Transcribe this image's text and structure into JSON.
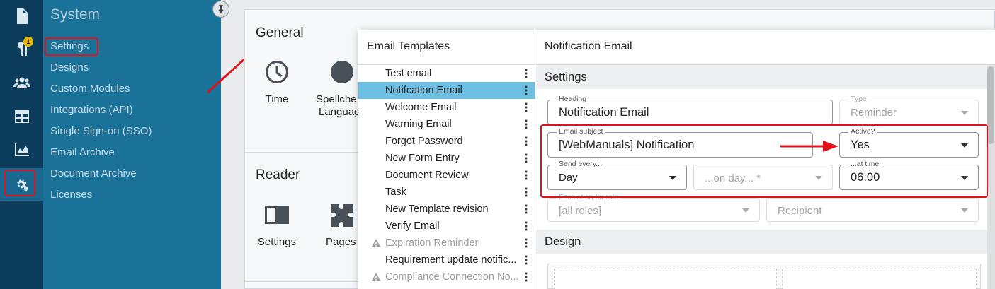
{
  "rail": {
    "badge_count": "1",
    "items": [
      "document-icon",
      "paragraph-icon",
      "users-icon",
      "table-icon",
      "chart-icon",
      "settings-gears-icon"
    ]
  },
  "sidemenu": {
    "title": "System",
    "items": [
      "Settings",
      "Designs",
      "Custom Modules",
      "Integrations (API)",
      "Single Sign-on (SSO)",
      "Email Archive",
      "Document Archive",
      "Licenses"
    ]
  },
  "background": {
    "general_heading": "General",
    "general_items": [
      "Time",
      "Spellche",
      "Languag"
    ],
    "reader_heading": "Reader",
    "reader_items": [
      "Settings",
      "Pages"
    ]
  },
  "email_templates": {
    "title": "Email Templates",
    "items": [
      {
        "label": "Test email",
        "warning": false
      },
      {
        "label": "Notifcation Email",
        "warning": false,
        "selected": true
      },
      {
        "label": "Welcome Email",
        "warning": false
      },
      {
        "label": "Warning Email",
        "warning": false
      },
      {
        "label": "Forgot Password",
        "warning": false
      },
      {
        "label": "New Form Entry",
        "warning": false
      },
      {
        "label": "Document Review",
        "warning": false
      },
      {
        "label": "Task",
        "warning": false
      },
      {
        "label": "New Template revision",
        "warning": false
      },
      {
        "label": "Verify Email",
        "warning": false
      },
      {
        "label": "Expiration Reminder",
        "warning": true
      },
      {
        "label": "Requirement update notific...",
        "warning": false
      },
      {
        "label": "Compliance Connection No...",
        "warning": true
      }
    ]
  },
  "editor": {
    "title": "Notification Email",
    "settings_heading": "Settings",
    "design_heading": "Design",
    "heading_field": {
      "label": "Heading",
      "value": "Notification Email"
    },
    "type_field": {
      "label": "Type",
      "value": "Reminder"
    },
    "subject_field": {
      "label": "Email subject",
      "value": "[WebManuals] Notification"
    },
    "active_field": {
      "label": "Active?",
      "value": "Yes"
    },
    "send_every_field": {
      "label": "Send every...",
      "value": "Day"
    },
    "on_day_field": {
      "label": "",
      "placeholder": "...on day... *"
    },
    "at_time_field": {
      "label": "...at time",
      "value": "06:00"
    },
    "escalation_field": {
      "label": "Escalation for role",
      "value": "[all roles]"
    },
    "recipient_field": {
      "label": "",
      "placeholder": "Recipient"
    }
  },
  "colors": {
    "rail_bg": "#0d3d5c",
    "sidemenu_bg": "#1a7299",
    "selected_row": "#6ec0e2",
    "highlight_red": "#e0121c"
  }
}
